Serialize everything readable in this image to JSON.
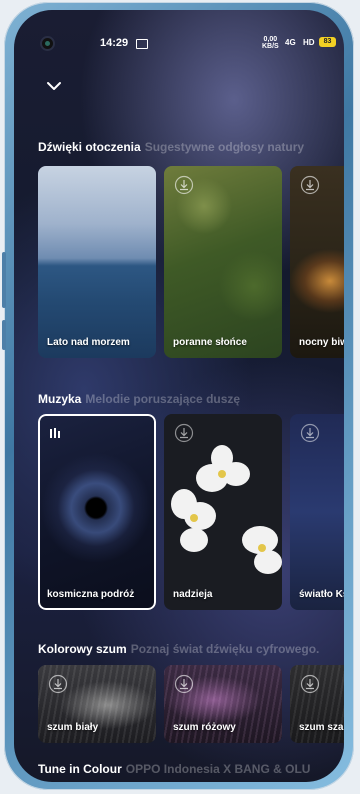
{
  "status_bar": {
    "time": "14:29",
    "net_speed_top": "0,00",
    "net_speed_bottom": "KB/S",
    "signal_1": "4G",
    "signal_2": "HD",
    "battery": "83"
  },
  "sections": [
    {
      "title": "Dźwięki otoczenia",
      "subtitle": "Sugestywne odgłosy natury",
      "cards": [
        {
          "label": "Lato nad morzem"
        },
        {
          "label": "poranne słońce"
        },
        {
          "label": "nocny biwak"
        }
      ]
    },
    {
      "title": "Muzyka",
      "subtitle": "Melodie poruszające duszę",
      "cards": [
        {
          "label": "kosmiczna podróż"
        },
        {
          "label": "nadzieja"
        },
        {
          "label": "światło Księżyca"
        }
      ]
    },
    {
      "title": "Kolorowy szum",
      "subtitle": "Poznaj świat dźwięku cyfrowego.",
      "cards": [
        {
          "label": "szum biały"
        },
        {
          "label": "szum różowy"
        },
        {
          "label": "szum szary"
        }
      ]
    },
    {
      "title": "Tune in Colour",
      "subtitle": "OPPO Indonesia X BANG & OLU",
      "cards": []
    }
  ],
  "colors": {
    "accent": "#ffffff",
    "subtitle": "rgba(255,255,255,0.28)",
    "battery": "#f2d024"
  },
  "icons": {
    "collapse": "chevron-down-icon",
    "download": "download-icon",
    "playing": "playing-bars-icon"
  }
}
